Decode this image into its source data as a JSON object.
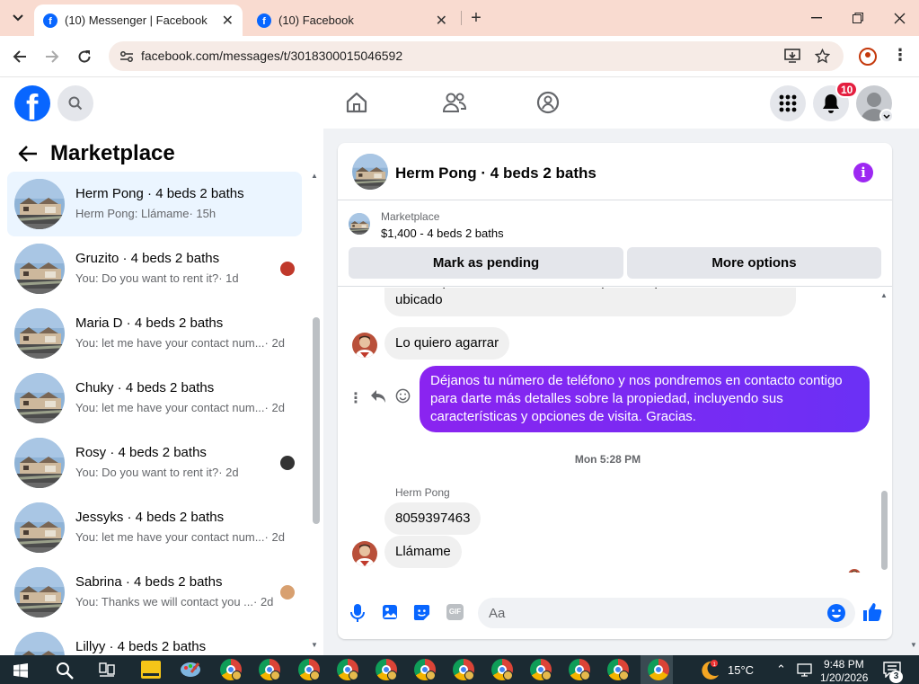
{
  "browser": {
    "tabs": [
      {
        "title": "(10) Messenger | Facebook",
        "active": true
      },
      {
        "title": "(10) Facebook",
        "active": false
      }
    ],
    "url": "facebook.com/messages/t/3018300015046592"
  },
  "fb": {
    "notification_count": "10"
  },
  "sidebar": {
    "title": "Marketplace",
    "conversations": [
      {
        "title": "Herm Pong · 4 beds 2 baths",
        "preview": "Herm Pong: Llámame",
        "time": "· 15h",
        "selected": true
      },
      {
        "title": "Gruzito · 4 beds 2 baths",
        "preview": "You: Do you want to rent it?",
        "time": "· 1d"
      },
      {
        "title": "Maria D · 4 beds 2 baths",
        "preview": "You: let me have your contact num...",
        "time": "· 2d"
      },
      {
        "title": "Chuky · 4 beds 2 baths",
        "preview": "You: let me have your contact num...",
        "time": "· 2d"
      },
      {
        "title": "Rosy · 4 beds 2 baths",
        "preview": "You: Do you want to rent it?",
        "time": "· 2d"
      },
      {
        "title": "Jessyks · 4 beds 2 baths",
        "preview": "You: let me have your contact num...",
        "time": "· 2d"
      },
      {
        "title": "Sabrina · 4 beds 2 baths",
        "preview": "You: Thanks we will contact you ...",
        "time": "· 2d"
      },
      {
        "title": "Lillyy · 4 beds 2 baths",
        "preview": "",
        "time": ""
      }
    ]
  },
  "chat": {
    "title": "Herm Pong · 4 beds 2 baths",
    "listing": {
      "label": "Marketplace",
      "detail": "$1,400 - 4 beds 2 baths"
    },
    "buttons": {
      "pending": "Mark as pending",
      "more": "More options"
    },
    "messages": {
      "m1": "Ok.  Me puede mantar la direccion para ver por donde esta ubicado",
      "m2": "Lo quiero agarrar",
      "mine": "Déjanos tu número de teléfono y nos pondremos en contacto contigo para darte más detalles sobre la propiedad, incluyendo sus características y opciones de visita. Gracias.",
      "timestamp": "Mon 5:28 PM",
      "sender": "Herm Pong",
      "m3": "8059397463",
      "m4": "Llámame"
    },
    "composer_placeholder": "Aa"
  },
  "taskbar": {
    "temperature": "15°C",
    "time": "9:48 PM",
    "date": "1/20/2026",
    "notif_count": "3"
  },
  "colors": {
    "fb_blue": "#0866ff",
    "messenger_purple": "#7b2cf3",
    "tabbar_bg": "#f9dbd0"
  },
  "icons": [
    "facebook-logo",
    "search-icon",
    "home-icon",
    "friends-icon",
    "groups-icon",
    "menu-grid-icon",
    "bell-icon",
    "avatar",
    "back-arrow-icon",
    "info-icon",
    "mic-icon",
    "image-icon",
    "sticker-icon",
    "gif-icon",
    "emoji-icon",
    "like-icon"
  ]
}
